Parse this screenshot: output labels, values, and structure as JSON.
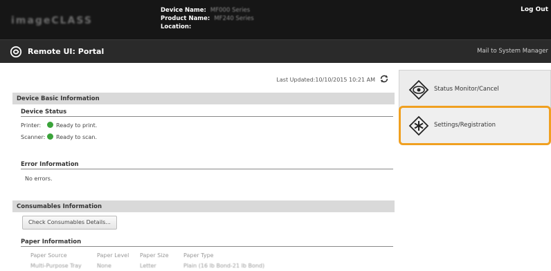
{
  "header": {
    "brand": "imageCLASS",
    "device_name_label": "Device Name:",
    "device_name_value": "MF000 Series",
    "product_name_label": "Product Name:",
    "product_name_value": "MF240 Series",
    "location_label": "Location:",
    "logout": "Log Out"
  },
  "portal": {
    "title": "Remote UI: Portal",
    "mail_link": "Mail to System Manager"
  },
  "main": {
    "last_updated": "Last Updated:10/10/2015 10:21 AM",
    "device_basic": {
      "heading": "Device Basic Information",
      "status_title": "Device Status",
      "printer_label": "Printer:",
      "printer_status": "Ready to print.",
      "scanner_label": "Scanner:",
      "scanner_status": "Ready to scan.",
      "error_title": "Error Information",
      "error_text": "No errors."
    },
    "consumables": {
      "heading": "Consumables Information",
      "check_button": "Check Consumables Details...",
      "paper_title": "Paper Information",
      "columns": [
        "Paper Source",
        "Paper Level",
        "Paper Size",
        "Paper Type"
      ],
      "rows": [
        [
          "Multi-Purpose Tray",
          "None",
          "Letter",
          "Plain (16 lb Bond-21 lb Bond)"
        ]
      ]
    }
  },
  "side": {
    "status_monitor": "Status Monitor/Cancel",
    "settings": "Settings/Registration"
  },
  "colors": {
    "highlight": "#f0a020",
    "status_ok": "#3aa33a"
  }
}
